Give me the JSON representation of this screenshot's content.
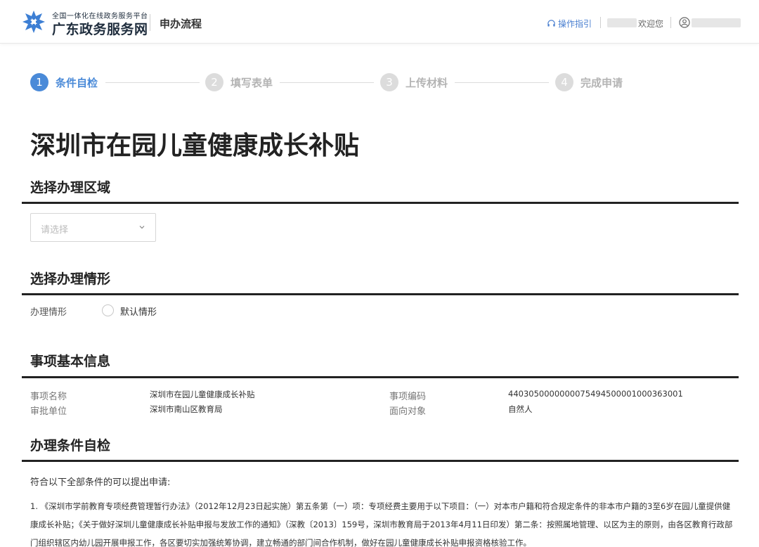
{
  "header": {
    "logo_subtitle": "全国一体化在线政务服务平台",
    "logo_title": "广东政务服务网",
    "section_title": "申办流程",
    "guide_link": "操作指引",
    "welcome": "欢迎您",
    "brand_color": "#4a8ad8"
  },
  "steps": [
    {
      "number": "1",
      "label": "条件自检",
      "active": true
    },
    {
      "number": "2",
      "label": "填写表单",
      "active": false
    },
    {
      "number": "3",
      "label": "上传材料",
      "active": false
    },
    {
      "number": "4",
      "label": "完成申请",
      "active": false
    }
  ],
  "page_title": "深圳市在园儿童健康成长补贴",
  "region": {
    "title": "选择办理区域",
    "placeholder": "请选择"
  },
  "situation": {
    "title": "选择办理情形",
    "label": "办理情形",
    "option": "默认情形"
  },
  "basic_info": {
    "title": "事项基本信息",
    "item_name_label": "事项名称",
    "item_name_value": "深圳市在园儿童健康成长补贴",
    "item_code_label": "事项编码",
    "item_code_value": "440305000000007549450000100036300​1",
    "approval_unit_label": "审批单位",
    "approval_unit_value": "深圳市南山区教育局",
    "target_label": "面向对象",
    "target_value": "自然人"
  },
  "conditions": {
    "title": "办理条件自检",
    "intro": "符合以下全部条件的可以提出申请:",
    "item1": "1. 《深圳市学前教育专项经费管理暂行办法》（2012年12月23日起实施）第五条第（一）项：专项经费主要用于以下项目：（一）对本市户籍和符合规定条件的非本市户籍的3至6岁在园儿童提供健康成长补贴；《关于做好深圳儿童健康成长补贴申报与发放工作的通知》（深教〔2013〕159号，深圳市教育局于2013年4月11日印发）第二条：按照属地管理、以区为主的原则，由各区教育行政部门组织辖区内幼儿园开展申报工作，各区要切实加强统筹协调，建立畅通的部门间合作机制，做好在园儿童健康成长补贴申报资格核验工作。"
  }
}
